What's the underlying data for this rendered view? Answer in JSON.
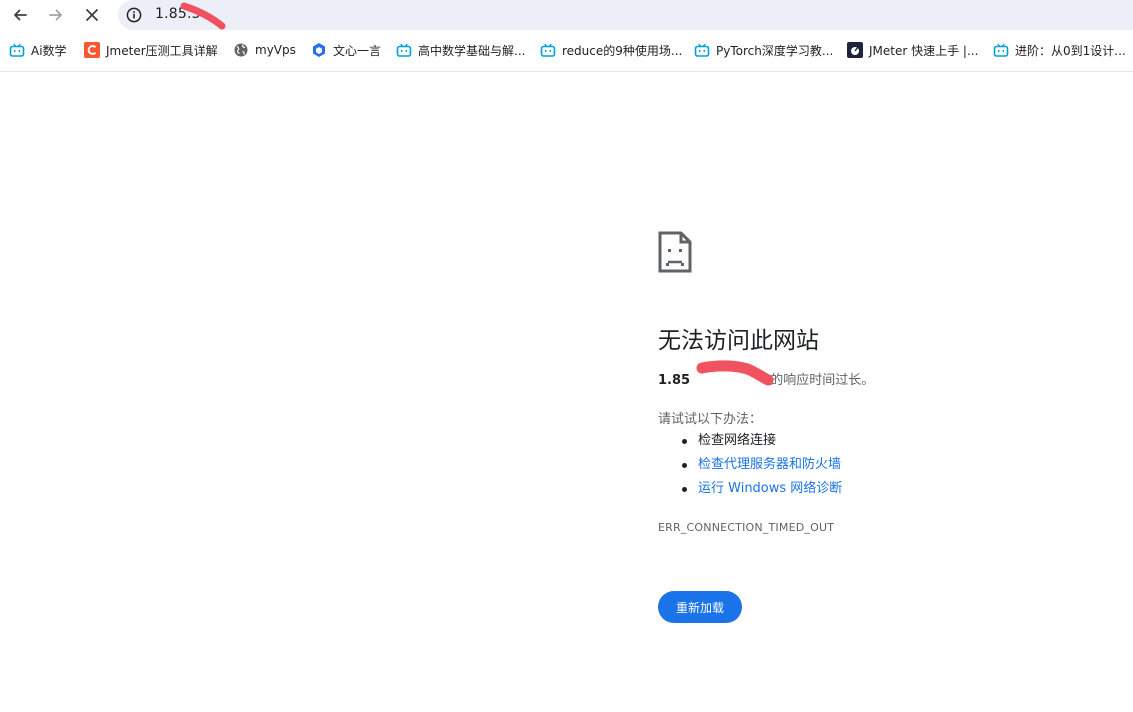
{
  "browser": {
    "url": "1.85.5",
    "colors": {
      "accent": "#1a73e8",
      "omnibox_bg": "#eceff7",
      "redaction": "#f0525f"
    }
  },
  "bookmarks": [
    {
      "label": "Ai数学",
      "icon": "bilibili-icon"
    },
    {
      "label": "Jmeter压测工具详解",
      "icon": "csdn-icon"
    },
    {
      "label": "myVps",
      "icon": "globe-icon"
    },
    {
      "label": "文心一言",
      "icon": "wenxin-icon"
    },
    {
      "label": "高中数学基础与解...",
      "icon": "bilibili-icon"
    },
    {
      "label": "reduce的9种使用场...",
      "icon": "bilibili-icon"
    },
    {
      "label": "PyTorch深度学习教...",
      "icon": "bilibili-icon"
    },
    {
      "label": "JMeter 快速上手 |...",
      "icon": "jmeter-icon"
    },
    {
      "label": "进阶：从0到1设计...",
      "icon": "bilibili-icon"
    }
  ],
  "error_page": {
    "icon": "sad-page-icon",
    "title": "无法访问此网站",
    "host": "1.85",
    "detail_suffix": " 的响应时间过长。",
    "suggestions_intro": "请试试以下办法：",
    "suggestions": [
      {
        "text": "检查网络连接",
        "link": false
      },
      {
        "text": "检查代理服务器和防火墙",
        "link": true
      },
      {
        "text": "运行 Windows 网络诊断",
        "link": true
      }
    ],
    "error_code": "ERR_CONNECTION_TIMED_OUT",
    "reload_label": "重新加载"
  }
}
